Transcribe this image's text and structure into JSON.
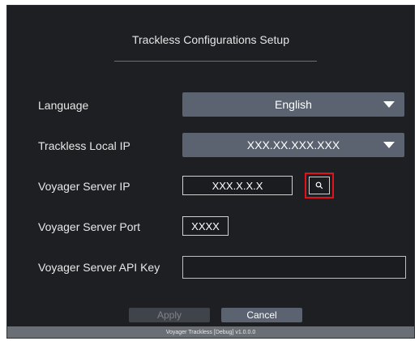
{
  "title": "Trackless Configurations Setup",
  "form": {
    "language": {
      "label": "Language",
      "value": "English"
    },
    "local_ip": {
      "label": "Trackless Local IP",
      "value": "XXX.XX.XXX.XXX"
    },
    "server_ip": {
      "label": "Voyager Server IP",
      "value": "XXX.X.X.X"
    },
    "server_port": {
      "label": "Voyager Server Port",
      "value": "XXXX"
    },
    "api_key": {
      "label": "Voyager Server API Key",
      "value": ""
    }
  },
  "buttons": {
    "apply": "Apply",
    "cancel": "Cancel"
  },
  "status": "Voyager Trackless [Debug] v1.0.0.0",
  "colors": {
    "background": "#1d1f23",
    "dropdown": "#5b6270",
    "highlight": "#e0131c"
  },
  "icons": [
    "chevron-down-icon",
    "search-icon"
  ]
}
